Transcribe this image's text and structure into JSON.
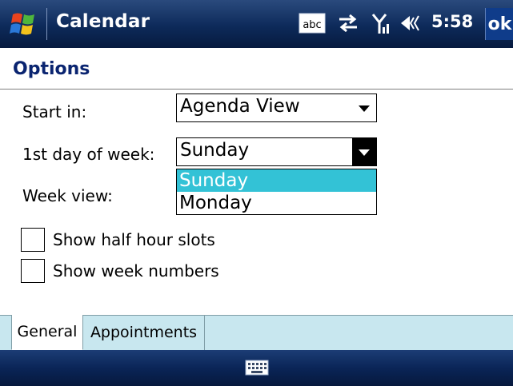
{
  "titlebar": {
    "app_title": "Calendar",
    "input_indicator": "abc",
    "clock": "5:58",
    "ok_label": "ok"
  },
  "page": {
    "title": "Options"
  },
  "form": {
    "start_in": {
      "label": "Start in:",
      "value": "Agenda View"
    },
    "first_day": {
      "label": "1st day of week:",
      "value": "Sunday",
      "options": [
        "Sunday",
        "Monday"
      ],
      "highlighted": "Sunday"
    },
    "week_view": {
      "label": "Week view:"
    },
    "half_hour": {
      "label": "Show half hour slots",
      "checked": false
    },
    "week_numbers": {
      "label": "Show week numbers",
      "checked": false
    }
  },
  "tabs": [
    {
      "label": "General",
      "active": true
    },
    {
      "label": "Appointments",
      "active": false
    }
  ],
  "colors": {
    "titlebar": "#0d2a5a",
    "heading": "#0a2470",
    "highlight": "#33c2d6",
    "tabbar": "#c8e7ef"
  },
  "icons": [
    "windows-start-icon",
    "input-method-icon",
    "sync-icon",
    "signal-icon",
    "volume-icon",
    "keyboard-icon"
  ]
}
